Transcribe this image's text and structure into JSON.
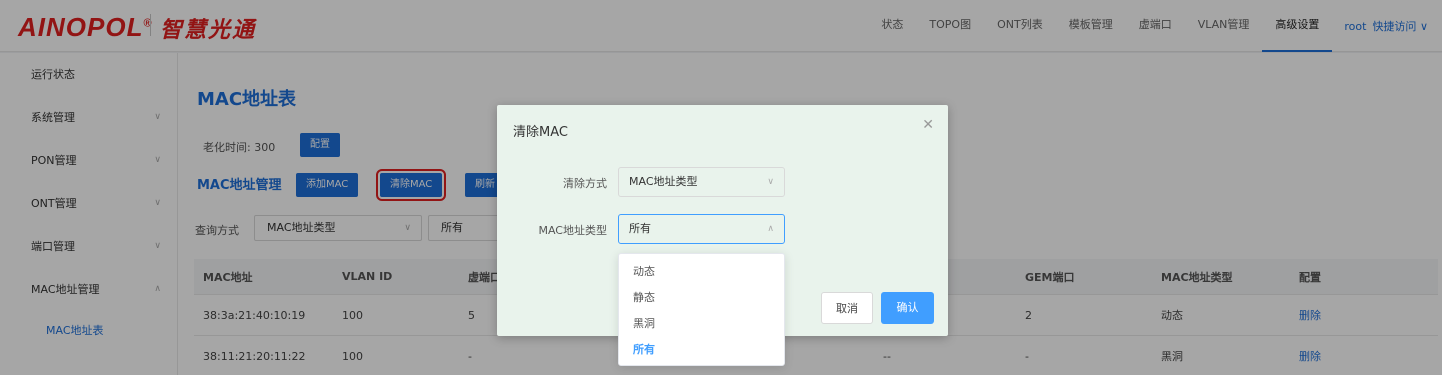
{
  "brand": {
    "logo": "AINOPOL",
    "logo_mark": "®",
    "slogan": "智慧光通"
  },
  "nav": {
    "items": [
      "状态",
      "TOPO图",
      "ONT列表",
      "模板管理",
      "虚端口",
      "VLAN管理",
      "高级设置"
    ],
    "active": "高级设置",
    "user": "root",
    "quick_access": "快捷访问"
  },
  "sidebar": {
    "items": [
      {
        "label": "运行状态"
      },
      {
        "label": "系统管理"
      },
      {
        "label": "PON管理"
      },
      {
        "label": "ONT管理"
      },
      {
        "label": "端口管理"
      },
      {
        "label": "MAC地址管理"
      }
    ],
    "subitem": "MAC地址表"
  },
  "main": {
    "title": "MAC地址表",
    "aging_label": "老化时间:",
    "aging_value": "300",
    "config_button": "配置",
    "section_title": "MAC地址管理",
    "add_button": "添加MAC",
    "clear_button": "清除MAC",
    "refresh_button": "刷新",
    "query_label": "查询方式",
    "query_type": "MAC地址类型",
    "query_value": "所有"
  },
  "table": {
    "columns": [
      "MAC地址",
      "VLAN ID",
      "虚端口",
      "GEM端口",
      "MAC地址类型",
      "配置"
    ],
    "rows": [
      {
        "mac": "38:3a:21:40:10:19",
        "vlan": "100",
        "vport": "5",
        "extra": "",
        "gem": "2",
        "type": "动态",
        "action": "删除"
      },
      {
        "mac": "38:11:21:20:11:22",
        "vlan": "100",
        "vport": "-",
        "extra": "--",
        "gem": "-",
        "type": "黑洞",
        "action": "删除"
      }
    ]
  },
  "modal": {
    "title": "清除MAC",
    "method_label": "清除方式",
    "method_value": "MAC地址类型",
    "type_label": "MAC地址类型",
    "type_value": "所有",
    "cancel": "取消",
    "confirm": "确认"
  },
  "dropdown": {
    "options": [
      "动态",
      "静态",
      "黑洞",
      "所有"
    ],
    "selected": "所有"
  }
}
